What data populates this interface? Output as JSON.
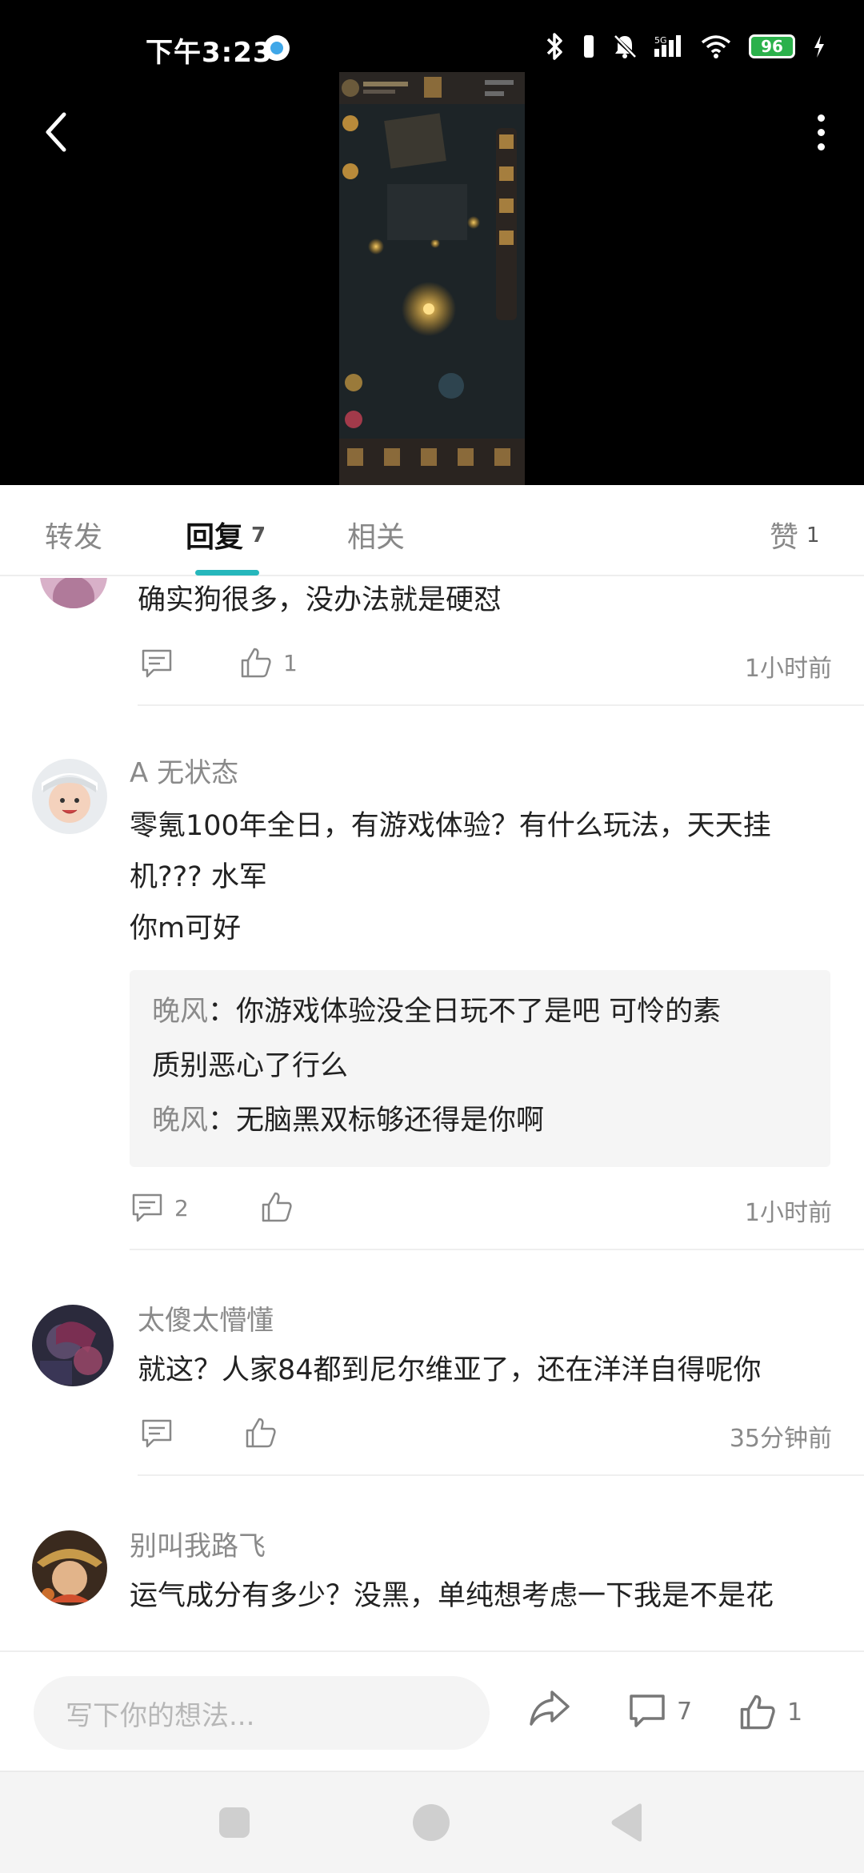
{
  "status_bar": {
    "time": "下午3:23",
    "battery": "96"
  },
  "tabs": [
    {
      "label": "转发"
    },
    {
      "label": "回复",
      "count": "7"
    },
    {
      "label": "相关"
    },
    {
      "label": "赞",
      "count": "1"
    }
  ],
  "comments": [
    {
      "text": "确实狗很多，没办法就是硬怼",
      "likes": "1",
      "time": "1小时前"
    },
    {
      "author": "A 无状态",
      "text_lines": [
        "零氪100年全日，有游戏体验？有什么玩法，天天挂",
        "机??? 水军",
        "你m可好"
      ],
      "replies": [
        {
          "name": "晚风",
          "sep": "：",
          "text": "你游戏体验没全日玩不了是吧  可怜的素"
        },
        {
          "name": "",
          "sep": "",
          "text": "质别恶心了行么"
        },
        {
          "name": "晚风",
          "sep": "：",
          "text": "无脑黑双标够还得是你啊"
        }
      ],
      "reply_count": "2",
      "time": "1小时前"
    },
    {
      "author": "太傻太懵懂",
      "text": "就这？人家84都到尼尔维亚了，还在洋洋自得呢你",
      "time": "35分钟前"
    },
    {
      "author": "别叫我路飞",
      "text": "运气成分有多少？没黑，单纯想考虑一下我是不是花"
    }
  ],
  "input_bar": {
    "placeholder": "写下你的想法...",
    "comment_count": "7",
    "like_count": "1"
  },
  "colors": {
    "accent": "#26b7bc",
    "battery": "#2bb14b",
    "muted_text": "#8a8a8a"
  }
}
